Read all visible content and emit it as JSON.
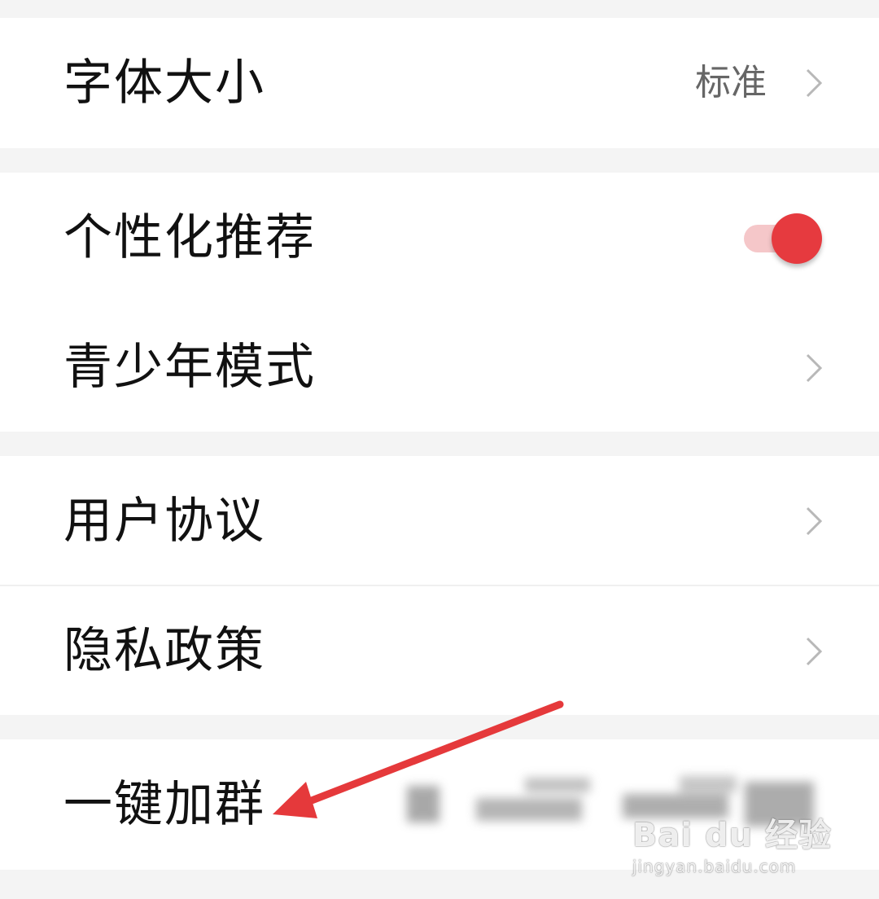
{
  "settings": {
    "font_size": {
      "label": "字体大小",
      "value": "标准"
    },
    "personalized": {
      "label": "个性化推荐",
      "enabled": true
    },
    "youth_mode": {
      "label": "青少年模式"
    },
    "user_agreement": {
      "label": "用户协议"
    },
    "privacy_policy": {
      "label": "隐私政策"
    },
    "join_group": {
      "label": "一键加群"
    }
  },
  "colors": {
    "accent": "#e63a3f",
    "annotation_arrow": "#e5393b"
  },
  "watermark": {
    "logo": "Bai du 经验",
    "url": "jingyan.baidu.com"
  }
}
